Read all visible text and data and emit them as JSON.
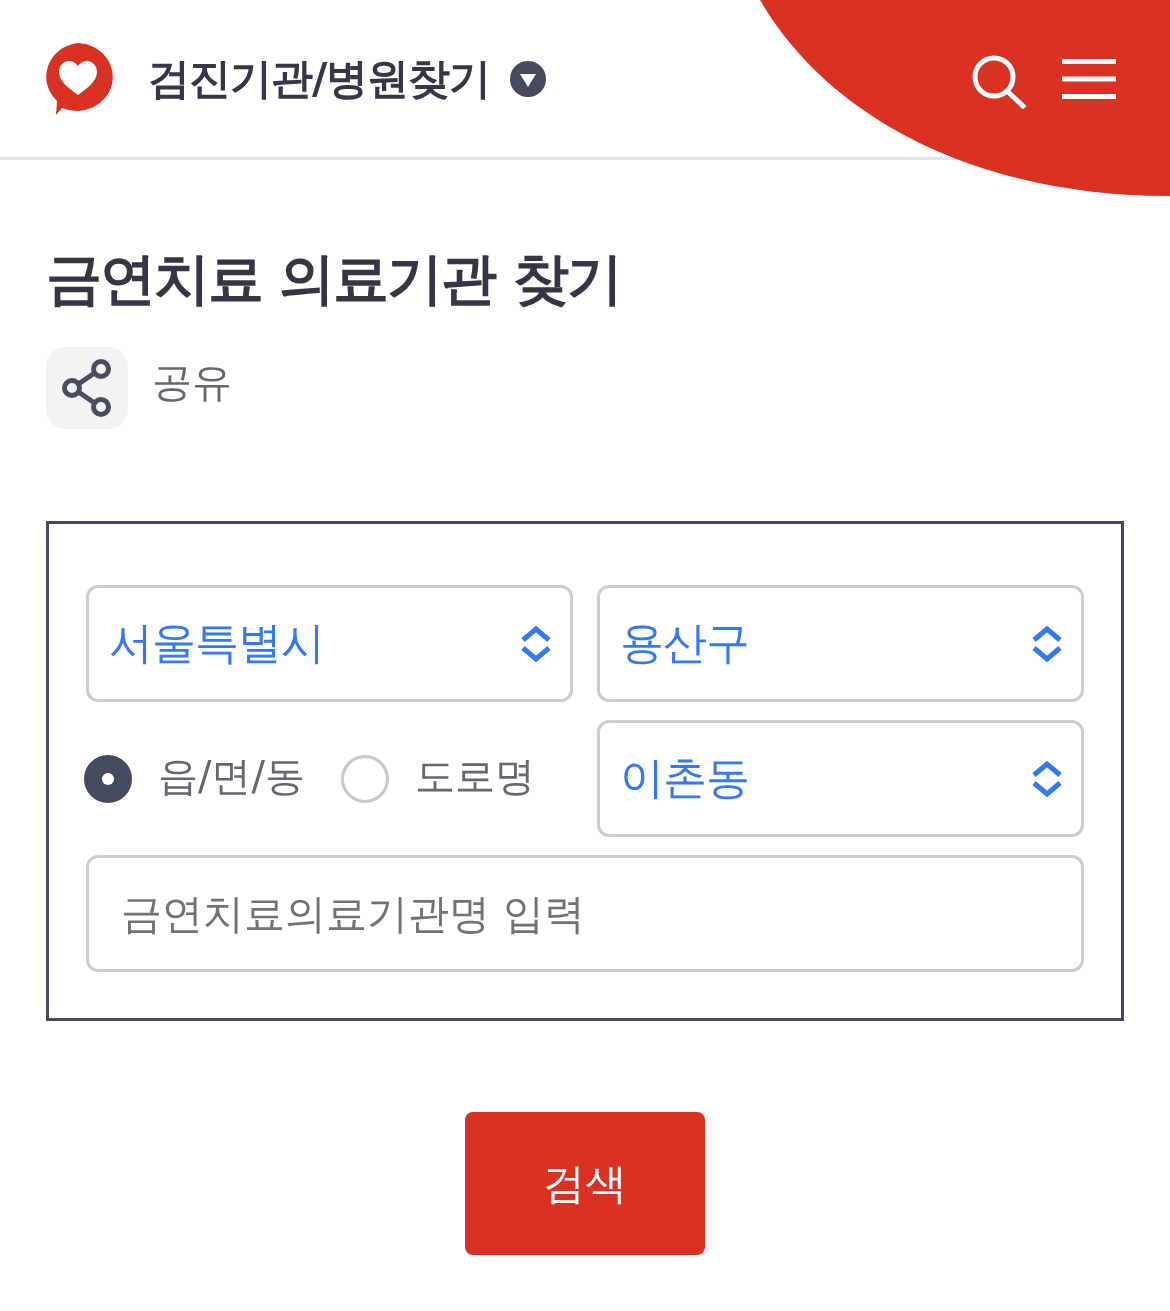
{
  "header": {
    "title": "검진기관/병원찾기"
  },
  "page": {
    "title": "금연치료 의료기관 찾기",
    "share_label": "공유"
  },
  "form": {
    "region_selects": [
      {
        "value": "서울특별시"
      },
      {
        "value": "용산구"
      }
    ],
    "address_types": [
      {
        "label": "읍/면/동",
        "selected": true
      },
      {
        "label": "도로명",
        "selected": false
      }
    ],
    "dong_select": {
      "value": "이촌동"
    },
    "name_input": {
      "placeholder": "금연치료의료기관명 입력"
    }
  },
  "search_button": {
    "label": "검색"
  }
}
